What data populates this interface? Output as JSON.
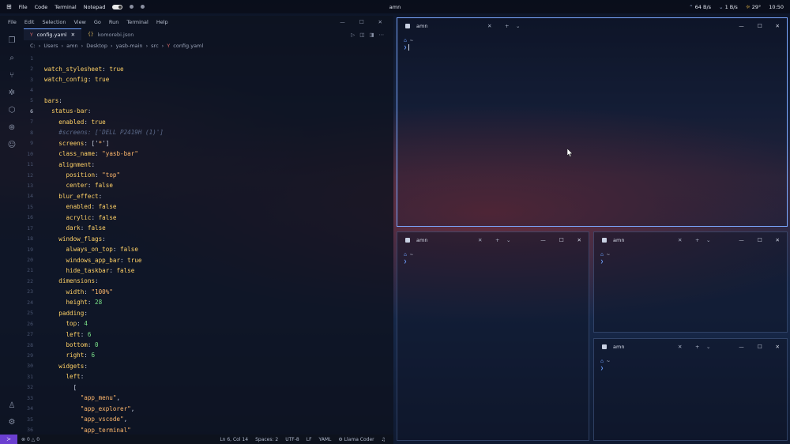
{
  "topbar": {
    "menu": [
      "File",
      "Code",
      "Terminal",
      "Notepad"
    ],
    "window_title": "amn",
    "net_down": "64 B/s",
    "net_up": "1 B/s",
    "weather": "29°",
    "clock": "10:50"
  },
  "vscode": {
    "menu": [
      "File",
      "Edit",
      "Selection",
      "View",
      "Go",
      "Run",
      "Terminal",
      "Help"
    ],
    "tabs": [
      {
        "label": "config.yaml",
        "active": true
      },
      {
        "label": "komorebi.json",
        "active": false
      }
    ],
    "breadcrumb": [
      "C:",
      "Users",
      "amn",
      "Desktop",
      "yasb-main",
      "src",
      "config.yaml"
    ],
    "status": {
      "problems": "0",
      "warnings": "0",
      "position": "Ln 6, Col 14",
      "spaces": "Spaces: 2",
      "encoding": "UTF-8",
      "eol": "LF",
      "language": "YAML",
      "assistant": "Llama Coder"
    },
    "lines": [
      {
        "n": "1",
        "parts": []
      },
      {
        "n": "2",
        "parts": [
          [
            "k",
            "watch_stylesheet"
          ],
          [
            "p",
            ": "
          ],
          [
            "k",
            "true"
          ]
        ]
      },
      {
        "n": "3",
        "parts": [
          [
            "k",
            "watch_config"
          ],
          [
            "p",
            ": "
          ],
          [
            "k",
            "true"
          ]
        ]
      },
      {
        "n": "4",
        "parts": []
      },
      {
        "n": "5",
        "parts": [
          [
            "k",
            "bars"
          ],
          [
            "p",
            ":"
          ]
        ]
      },
      {
        "n": "6",
        "parts": [
          [
            "p",
            "  "
          ],
          [
            "k",
            "status-bar"
          ],
          [
            "p",
            ":"
          ]
        ],
        "cur": true
      },
      {
        "n": "7",
        "parts": [
          [
            "p",
            "    "
          ],
          [
            "k",
            "enabled"
          ],
          [
            "p",
            ": "
          ],
          [
            "k",
            "true"
          ]
        ]
      },
      {
        "n": "8",
        "parts": [
          [
            "p",
            "    "
          ],
          [
            "c",
            "#screens: ['DELL P2419H (1)']"
          ]
        ]
      },
      {
        "n": "9",
        "parts": [
          [
            "p",
            "    "
          ],
          [
            "k",
            "screens"
          ],
          [
            "p",
            ": ['"
          ],
          [
            "s",
            "*"
          ],
          [
            "p",
            "']"
          ]
        ]
      },
      {
        "n": "10",
        "parts": [
          [
            "p",
            "    "
          ],
          [
            "k",
            "class_name"
          ],
          [
            "p",
            ": "
          ],
          [
            "s",
            "\"yasb-bar\""
          ]
        ]
      },
      {
        "n": "11",
        "parts": [
          [
            "p",
            "    "
          ],
          [
            "k",
            "alignment"
          ],
          [
            "p",
            ":"
          ]
        ]
      },
      {
        "n": "12",
        "parts": [
          [
            "p",
            "      "
          ],
          [
            "k",
            "position"
          ],
          [
            "p",
            ": "
          ],
          [
            "s",
            "\"top\""
          ]
        ]
      },
      {
        "n": "13",
        "parts": [
          [
            "p",
            "      "
          ],
          [
            "k",
            "center"
          ],
          [
            "p",
            ": "
          ],
          [
            "k",
            "false"
          ]
        ]
      },
      {
        "n": "14",
        "parts": [
          [
            "p",
            "    "
          ],
          [
            "k",
            "blur_effect"
          ],
          [
            "p",
            ":"
          ]
        ]
      },
      {
        "n": "15",
        "parts": [
          [
            "p",
            "      "
          ],
          [
            "k",
            "enabled"
          ],
          [
            "p",
            ": "
          ],
          [
            "k",
            "false"
          ]
        ]
      },
      {
        "n": "16",
        "parts": [
          [
            "p",
            "      "
          ],
          [
            "k",
            "acrylic"
          ],
          [
            "p",
            ": "
          ],
          [
            "k",
            "false"
          ]
        ]
      },
      {
        "n": "17",
        "parts": [
          [
            "p",
            "      "
          ],
          [
            "k",
            "dark"
          ],
          [
            "p",
            ": "
          ],
          [
            "k",
            "false"
          ]
        ]
      },
      {
        "n": "18",
        "parts": [
          [
            "p",
            "    "
          ],
          [
            "k",
            "window_flags"
          ],
          [
            "p",
            ":"
          ]
        ]
      },
      {
        "n": "19",
        "parts": [
          [
            "p",
            "      "
          ],
          [
            "k",
            "always_on_top"
          ],
          [
            "p",
            ": "
          ],
          [
            "k",
            "false"
          ]
        ]
      },
      {
        "n": "20",
        "parts": [
          [
            "p",
            "      "
          ],
          [
            "k",
            "windows_app_bar"
          ],
          [
            "p",
            ": "
          ],
          [
            "k",
            "true"
          ]
        ]
      },
      {
        "n": "21",
        "parts": [
          [
            "p",
            "      "
          ],
          [
            "k",
            "hide_taskbar"
          ],
          [
            "p",
            ": "
          ],
          [
            "k",
            "false"
          ]
        ]
      },
      {
        "n": "22",
        "parts": [
          [
            "p",
            "    "
          ],
          [
            "k",
            "dimensions"
          ],
          [
            "p",
            ":"
          ]
        ]
      },
      {
        "n": "23",
        "parts": [
          [
            "p",
            "      "
          ],
          [
            "k",
            "width"
          ],
          [
            "p",
            ": "
          ],
          [
            "s",
            "\"100%\""
          ]
        ]
      },
      {
        "n": "24",
        "parts": [
          [
            "p",
            "      "
          ],
          [
            "k",
            "height"
          ],
          [
            "p",
            ": "
          ],
          [
            "n",
            "28"
          ]
        ]
      },
      {
        "n": "25",
        "parts": [
          [
            "p",
            "    "
          ],
          [
            "k",
            "padding"
          ],
          [
            "p",
            ":"
          ]
        ]
      },
      {
        "n": "26",
        "parts": [
          [
            "p",
            "      "
          ],
          [
            "k",
            "top"
          ],
          [
            "p",
            ": "
          ],
          [
            "n",
            "4"
          ]
        ]
      },
      {
        "n": "27",
        "parts": [
          [
            "p",
            "      "
          ],
          [
            "k",
            "left"
          ],
          [
            "p",
            ": "
          ],
          [
            "n",
            "6"
          ]
        ]
      },
      {
        "n": "28",
        "parts": [
          [
            "p",
            "      "
          ],
          [
            "k",
            "bottom"
          ],
          [
            "p",
            ": "
          ],
          [
            "n",
            "0"
          ]
        ]
      },
      {
        "n": "29",
        "parts": [
          [
            "p",
            "      "
          ],
          [
            "k",
            "right"
          ],
          [
            "p",
            ": "
          ],
          [
            "n",
            "6"
          ]
        ]
      },
      {
        "n": "30",
        "parts": [
          [
            "p",
            "    "
          ],
          [
            "k",
            "widgets"
          ],
          [
            "p",
            ":"
          ]
        ]
      },
      {
        "n": "31",
        "parts": [
          [
            "p",
            "      "
          ],
          [
            "k",
            "left"
          ],
          [
            "p",
            ":"
          ]
        ]
      },
      {
        "n": "32",
        "parts": [
          [
            "p",
            "        ["
          ]
        ]
      },
      {
        "n": "33",
        "parts": [
          [
            "p",
            "          "
          ],
          [
            "s",
            "\"app_menu\""
          ],
          [
            "p",
            ","
          ]
        ]
      },
      {
        "n": "34",
        "parts": [
          [
            "p",
            "          "
          ],
          [
            "s",
            "\"app_explorer\""
          ],
          [
            "p",
            ","
          ]
        ]
      },
      {
        "n": "35",
        "parts": [
          [
            "p",
            "          "
          ],
          [
            "s",
            "\"app_vscode\""
          ],
          [
            "p",
            ","
          ]
        ]
      },
      {
        "n": "36",
        "parts": [
          [
            "p",
            "          "
          ],
          [
            "s",
            "\"app_terminal\""
          ]
        ]
      }
    ]
  },
  "terminals": [
    {
      "id": "main",
      "tab": "amn",
      "prompt_dir": "~",
      "prompt_char": "❯",
      "focused": true
    },
    {
      "id": "bottom-left",
      "tab": "amn",
      "prompt_dir": "~",
      "prompt_char": "❯",
      "focused": false
    },
    {
      "id": "middle-right",
      "tab": "amn",
      "prompt_dir": "~",
      "prompt_char": "❯",
      "focused": false
    },
    {
      "id": "bottom-right",
      "tab": "amn",
      "prompt_dir": "~",
      "prompt_char": "❯",
      "focused": false
    }
  ],
  "colors": {
    "accent": "#7aa7ff",
    "remote_badge": "#6b3fd0",
    "yaml_key": "#ffd166",
    "yaml_string": "#ffb86c",
    "yaml_number": "#7be38a"
  }
}
